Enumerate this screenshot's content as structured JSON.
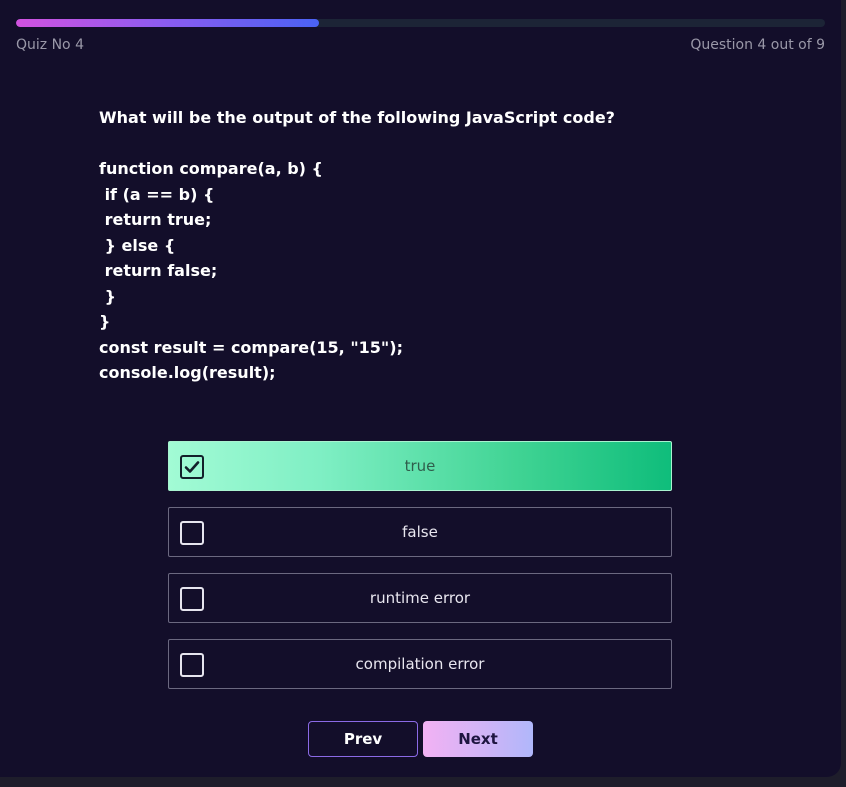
{
  "progress": {
    "fraction": 0.375,
    "quiz_label": "Quiz No 4",
    "counter": "Question 4 out of 9"
  },
  "question": {
    "lines": [
      "What will be the output of the following JavaScript code?",
      "",
      "function compare(a, b) {",
      " if (a == b) {",
      " return true;",
      " } else {",
      " return false;",
      " }",
      "}",
      "const result = compare(15, \"15\");",
      "console.log(result);"
    ]
  },
  "options": [
    {
      "label": "true",
      "checked": true
    },
    {
      "label": "false",
      "checked": false
    },
    {
      "label": "runtime error",
      "checked": false
    },
    {
      "label": "compilation error",
      "checked": false
    }
  ],
  "nav": {
    "prev_label": "Prev",
    "next_label": "Next"
  },
  "icons": {
    "checked": "check-icon"
  },
  "colors": {
    "background": "#130e2a",
    "selected_start": "#a2fbd5",
    "selected_end": "#0fbd7b",
    "progress_start": "#d252e0",
    "progress_end": "#4a62f4",
    "next_start": "#f2b2f4",
    "next_end": "#b0b7fb"
  }
}
